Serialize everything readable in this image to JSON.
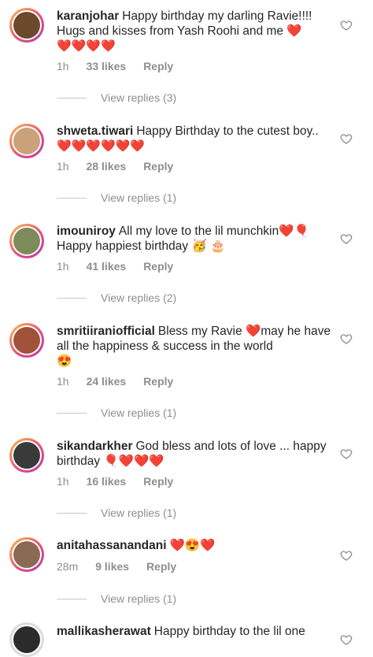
{
  "comments": [
    {
      "username": "karanjohar",
      "text": "Happy birthday my darling Ravie!!!! Hugs and kisses from Yash Roohi and me ❤️",
      "emoji": "❤️❤️❤️❤️",
      "time": "1h",
      "likes": "33 likes",
      "reply": "Reply",
      "view_replies": "View replies (3)"
    },
    {
      "username": "shweta.tiwari",
      "text": "Happy Birthday to the cutest boy..",
      "emoji": "❤️❤️❤️❤️❤️❤️",
      "time": "1h",
      "likes": "28 likes",
      "reply": "Reply",
      "view_replies": "View replies (1)"
    },
    {
      "username": "imouniroy",
      "text": "All my love to the lil munchkin❤️🎈",
      "emoji": "Happy happiest birthday 🥳 🎂",
      "time": "1h",
      "likes": "41 likes",
      "reply": "Reply",
      "view_replies": "View replies (2)"
    },
    {
      "username": "smritiiraniofficial",
      "text": "Bless my Ravie ❤️may he have all the happiness & success in the world",
      "emoji": "😍",
      "time": "1h",
      "likes": "24 likes",
      "reply": "Reply",
      "view_replies": "View replies (1)"
    },
    {
      "username": "sikandarkher",
      "text": "God bless and lots of love ... happy birthday 🎈❤️❤️❤️",
      "emoji": "",
      "time": "1h",
      "likes": "16 likes",
      "reply": "Reply",
      "view_replies": "View replies (1)"
    },
    {
      "username": "anitahassanandani",
      "text": "❤️😍❤️",
      "emoji": "",
      "time": "28m",
      "likes": "9 likes",
      "reply": "Reply",
      "view_replies": "View replies (1)"
    },
    {
      "username": "mallikasherawat",
      "text": "Happy birthday to the lil one",
      "emoji": "",
      "time": "",
      "likes": "",
      "reply": "",
      "view_replies": ""
    }
  ],
  "icons": {
    "like": "heart-outline-icon",
    "avatar": "avatar-icon"
  },
  "colors": {
    "heart": "#e0182d",
    "muted": "#8e8e8e",
    "ring": "#e94e77"
  }
}
